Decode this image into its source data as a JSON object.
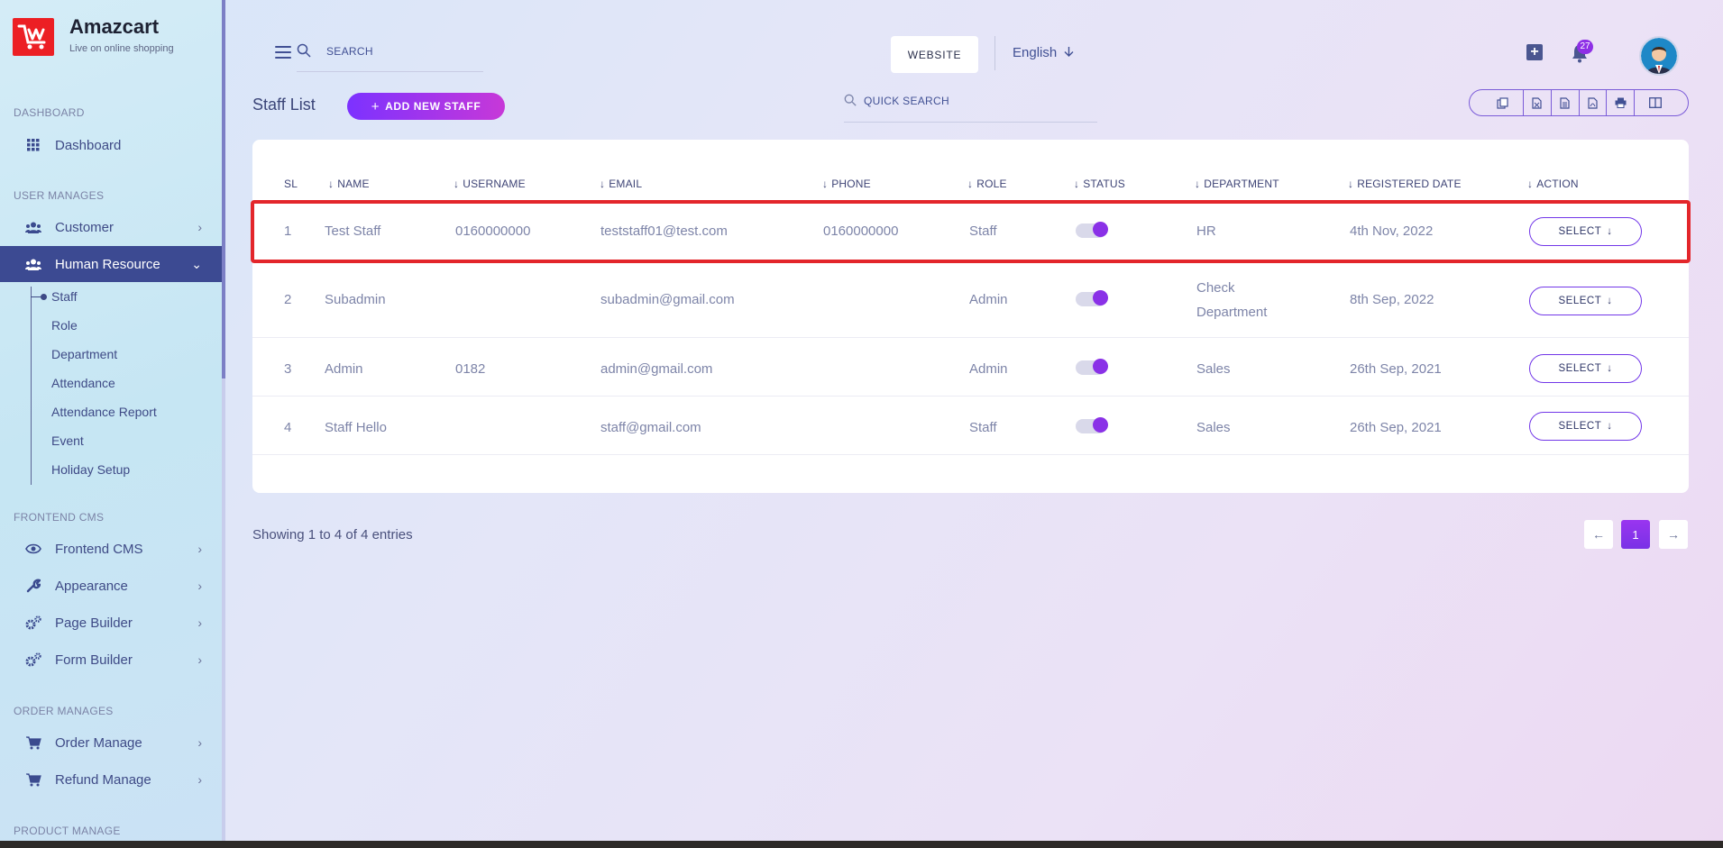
{
  "brand": {
    "name": "Amazcart",
    "tagline": "Live on online shopping"
  },
  "sidebar": {
    "sections": [
      {
        "label": "DASHBOARD"
      },
      {
        "label": "USER MANAGES"
      },
      {
        "label": "FRONTEND CMS"
      },
      {
        "label": "ORDER MANAGES"
      },
      {
        "label": "PRODUCT MANAGE"
      }
    ],
    "items": [
      {
        "label": "Dashboard",
        "icon": "grid-icon"
      },
      {
        "label": "Customer",
        "icon": "users-icon"
      },
      {
        "label": "Human Resource",
        "icon": "users-icon",
        "active": true
      },
      {
        "label": "Frontend CMS",
        "icon": "eye-icon"
      },
      {
        "label": "Appearance",
        "icon": "wrench-icon"
      },
      {
        "label": "Page Builder",
        "icon": "gears-icon"
      },
      {
        "label": "Form Builder",
        "icon": "gears-icon"
      },
      {
        "label": "Order Manage",
        "icon": "cart-icon"
      },
      {
        "label": "Refund Manage",
        "icon": "cart-icon"
      }
    ],
    "submenu": [
      "Staff",
      "Role",
      "Department",
      "Attendance",
      "Attendance Report",
      "Event",
      "Holiday Setup"
    ]
  },
  "header": {
    "search_placeholder": "SEARCH",
    "website_label": "WEBSITE",
    "language": "English",
    "notification_count": "27"
  },
  "page": {
    "title": "Staff List",
    "add_button": "ADD NEW STAFF",
    "quick_search_placeholder": "QUICK SEARCH",
    "export_buttons": [
      "copy-icon",
      "excel-icon",
      "csv-icon",
      "pdf-icon",
      "print-icon",
      "columns-icon"
    ]
  },
  "table": {
    "columns": [
      "SL",
      "NAME",
      "USERNAME",
      "EMAIL",
      "PHONE",
      "ROLE",
      "STATUS",
      "DEPARTMENT",
      "REGISTERED DATE",
      "ACTION"
    ],
    "rows": [
      {
        "sl": "1",
        "name": "Test Staff",
        "username": "0160000000",
        "email": "teststaff01@test.com",
        "phone": "0160000000",
        "role": "Staff",
        "status": true,
        "department": "HR",
        "department2": "",
        "date": "4th Nov, 2022",
        "action": "SELECT"
      },
      {
        "sl": "2",
        "name": "Subadmin",
        "username": "",
        "email": "subadmin@gmail.com",
        "phone": "",
        "role": "Admin",
        "status": true,
        "department": "Check",
        "department2": "Department",
        "date": "8th Sep, 2022",
        "action": "SELECT"
      },
      {
        "sl": "3",
        "name": "Admin",
        "username": "0182",
        "email": "admin@gmail.com",
        "phone": "",
        "role": "Admin",
        "status": true,
        "department": "Sales",
        "department2": "",
        "date": "26th Sep, 2021",
        "action": "SELECT"
      },
      {
        "sl": "4",
        "name": "Staff Hello",
        "username": "",
        "email": "staff@gmail.com",
        "phone": "",
        "role": "Staff",
        "status": true,
        "department": "Sales",
        "department2": "",
        "date": "26th Sep, 2021",
        "action": "SELECT"
      }
    ]
  },
  "footer": {
    "entries_text": "Showing 1 to 4 of 4 entries",
    "current_page": "1"
  },
  "colors": {
    "accent": "#7c32ff",
    "sidebar_active": "#3c4a92",
    "highlight": "#e3262b"
  }
}
